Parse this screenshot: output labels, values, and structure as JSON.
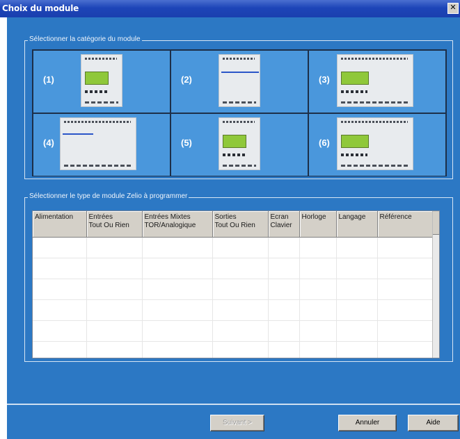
{
  "window": {
    "title": "Choix du module"
  },
  "category_group": {
    "legend": "Sélectionner la catégorie du module",
    "cells": [
      {
        "label": "(1)"
      },
      {
        "label": "(2)"
      },
      {
        "label": "(3)"
      },
      {
        "label": "(4)"
      },
      {
        "label": "(5)"
      },
      {
        "label": "(6)"
      }
    ]
  },
  "type_group": {
    "legend": "Sélectionner le type de module Zelio à programmer",
    "columns": [
      "Alimentation",
      "Entrées\nTout Ou Rien",
      "Entrées Mixtes\nTOR/Analogique",
      "Sorties\nTout Ou Rien",
      "Ecran\nClavier",
      "Horloge",
      "Langage",
      "Référence"
    ],
    "rows": [
      [
        "",
        "",
        "",
        "",
        "",
        "",
        "",
        ""
      ],
      [
        "",
        "",
        "",
        "",
        "",
        "",
        "",
        ""
      ],
      [
        "",
        "",
        "",
        "",
        "",
        "",
        "",
        ""
      ],
      [
        "",
        "",
        "",
        "",
        "",
        "",
        "",
        ""
      ],
      [
        "",
        "",
        "",
        "",
        "",
        "",
        "",
        ""
      ],
      [
        "",
        "",
        "",
        "",
        "",
        "",
        "",
        ""
      ]
    ]
  },
  "buttons": {
    "suivant": "Suivant >",
    "annuler": "Annuler",
    "aide": "Aide"
  }
}
